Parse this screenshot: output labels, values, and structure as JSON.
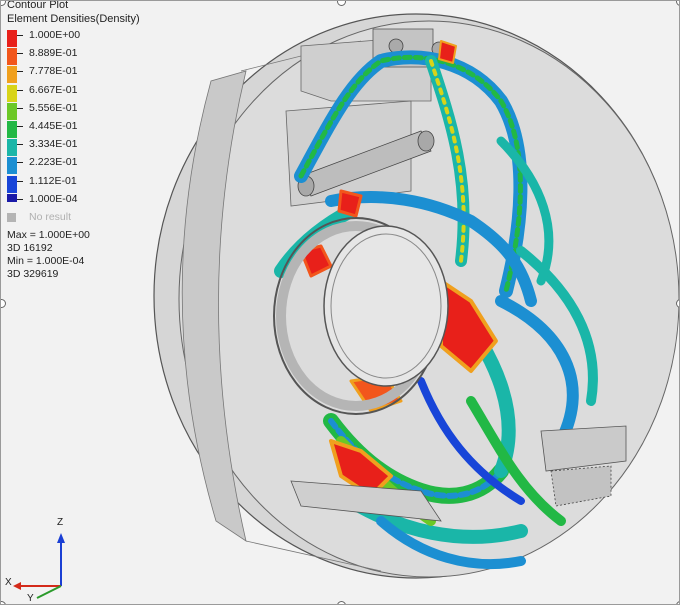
{
  "legend": {
    "title": "Contour Plot",
    "subtitle": "Element Densities(Density)",
    "levels": [
      {
        "label": "1.000E+00",
        "color": "#e8201a"
      },
      {
        "label": "8.889E-01",
        "color": "#f2561c"
      },
      {
        "label": "7.778E-01",
        "color": "#f0a01e"
      },
      {
        "label": "6.667E-01",
        "color": "#d8d418"
      },
      {
        "label": "5.556E-01",
        "color": "#6cc826"
      },
      {
        "label": "4.445E-01",
        "color": "#22b845"
      },
      {
        "label": "3.334E-01",
        "color": "#1ab6a8"
      },
      {
        "label": "2.223E-01",
        "color": "#1c8fd2"
      },
      {
        "label": "1.112E-01",
        "color": "#1845d8"
      },
      {
        "label": "1.000E-04",
        "color": "#1a1aa8"
      }
    ],
    "no_result_label": "No result",
    "no_result_color": "#b4b4b4"
  },
  "stats": {
    "max_line": "Max = 1.000E+00",
    "max_element": "3D 16192",
    "min_line": "Min = 1.000E-04",
    "min_element": "3D 329619"
  },
  "triad": {
    "z_label": "Z",
    "x_label": "X",
    "y_label": "Y",
    "z_color": "#1a3fd4",
    "x_color": "#d42a1a",
    "y_color": "#2a9a2a"
  },
  "colors": {
    "background": "#f2f2f2",
    "housing_fill": "#d2d2d2",
    "housing_edge": "#555555"
  }
}
